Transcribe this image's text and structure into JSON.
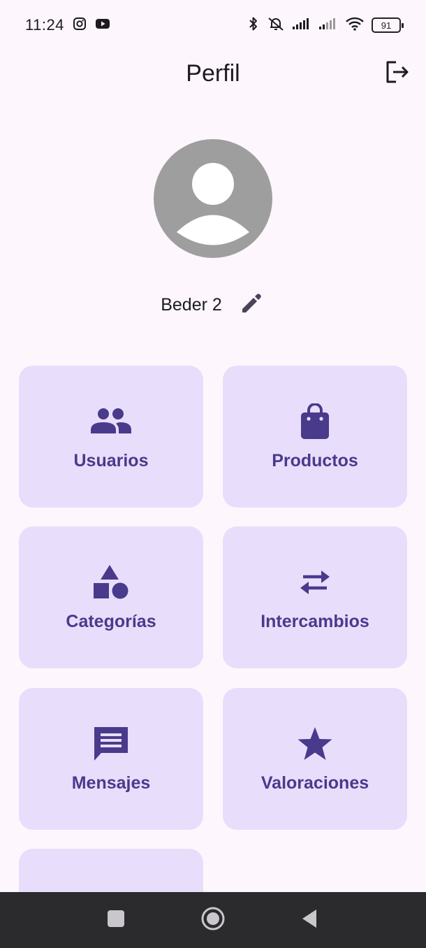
{
  "status_bar": {
    "time": "11:24",
    "battery": "91",
    "icons": [
      "instagram-icon",
      "youtube-icon",
      "bluetooth-icon",
      "bell-off-icon",
      "signal-icon",
      "signal-icon",
      "wifi-icon",
      "battery-icon"
    ]
  },
  "app_bar": {
    "title": "Perfil",
    "logout_icon": "logout-icon"
  },
  "profile": {
    "name": "Beder 2",
    "avatar_icon": "person-placeholder-icon",
    "edit_icon": "pencil-icon"
  },
  "menu": {
    "items": [
      {
        "label": "Usuarios",
        "icon": "people-icon"
      },
      {
        "label": "Productos",
        "icon": "shopping-bag-icon"
      },
      {
        "label": "Categorías",
        "icon": "category-shapes-icon"
      },
      {
        "label": "Intercambios",
        "icon": "swap-arrows-icon"
      },
      {
        "label": "Mensajes",
        "icon": "message-icon"
      },
      {
        "label": "Valoraciones",
        "icon": "star-icon"
      },
      {
        "label": "",
        "icon": "house-icon"
      }
    ]
  },
  "colors": {
    "background": "#fdf7fd",
    "card": "#e8defb",
    "accent": "#4a3a8c",
    "avatar": "#9e9e9e",
    "nav_bar": "#2b2a2c"
  },
  "system_nav": {
    "icons": [
      "recents-square-icon",
      "home-circle-icon",
      "back-triangle-icon"
    ]
  }
}
